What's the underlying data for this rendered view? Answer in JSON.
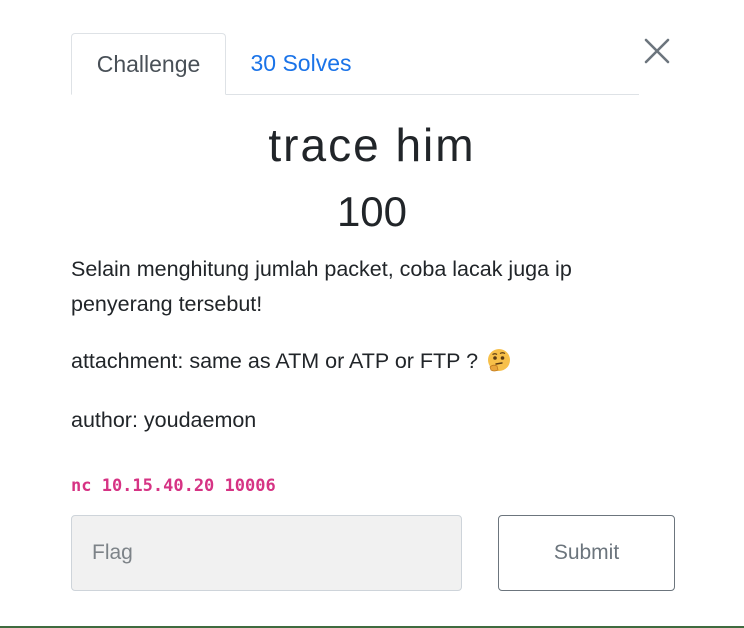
{
  "tabs": [
    {
      "label": "Challenge",
      "active": true
    },
    {
      "label": "30 Solves",
      "active": false
    }
  ],
  "challenge": {
    "name": "trace him",
    "value": "100",
    "description": "Selain menghitung jumlah packet, coba lacak juga ip penyerang tersebut!",
    "attachment": "attachment: same as ATM or ATP or FTP ?",
    "author": "author: youdaemon",
    "connection": "nc 10.15.40.20 10006"
  },
  "form": {
    "flag_placeholder": "Flag",
    "submit_label": "Submit"
  },
  "icons": {
    "close": "close-icon",
    "emoji": "thinking-face-icon"
  },
  "colors": {
    "link": "#1a73e8",
    "code": "#d63384",
    "input_bg": "#f1f1f1",
    "button_border": "#6c757d"
  }
}
